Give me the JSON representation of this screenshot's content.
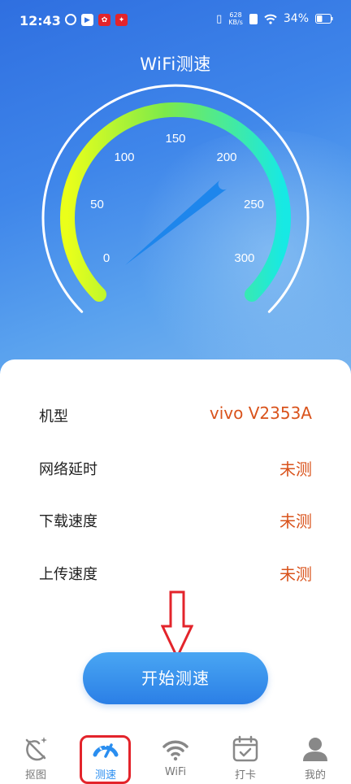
{
  "status_bar": {
    "time": "12:43",
    "net_speed_value": "628",
    "net_speed_unit": "KB/s",
    "battery": "34%"
  },
  "title": "WiFi测速",
  "gauge": {
    "tick_labels": [
      "0",
      "50",
      "100",
      "150",
      "200",
      "250",
      "300"
    ],
    "needle_value": 0,
    "arc_gradient": [
      "#eaff1a",
      "#7dea4a",
      "#17e9e4"
    ]
  },
  "info": {
    "rows": [
      {
        "label": "机型",
        "value": "vivo V2353A"
      },
      {
        "label": "网络延时",
        "value": "未测"
      },
      {
        "label": "下载速度",
        "value": "未测"
      },
      {
        "label": "上传速度",
        "value": "未测"
      }
    ]
  },
  "start_button": "开始测速",
  "tabs": [
    {
      "label": "抠图",
      "icon": "cutout-icon",
      "active": false
    },
    {
      "label": "测速",
      "icon": "speedometer-icon",
      "active": true
    },
    {
      "label": "WiFi",
      "icon": "wifi-icon",
      "active": false
    },
    {
      "label": "打卡",
      "icon": "calendar-check-icon",
      "active": false
    },
    {
      "label": "我的",
      "icon": "user-icon",
      "active": false
    }
  ],
  "colors": {
    "accent": "#2a8ef0",
    "value_orange": "#d9531c",
    "highlight_red": "#e3242b"
  }
}
